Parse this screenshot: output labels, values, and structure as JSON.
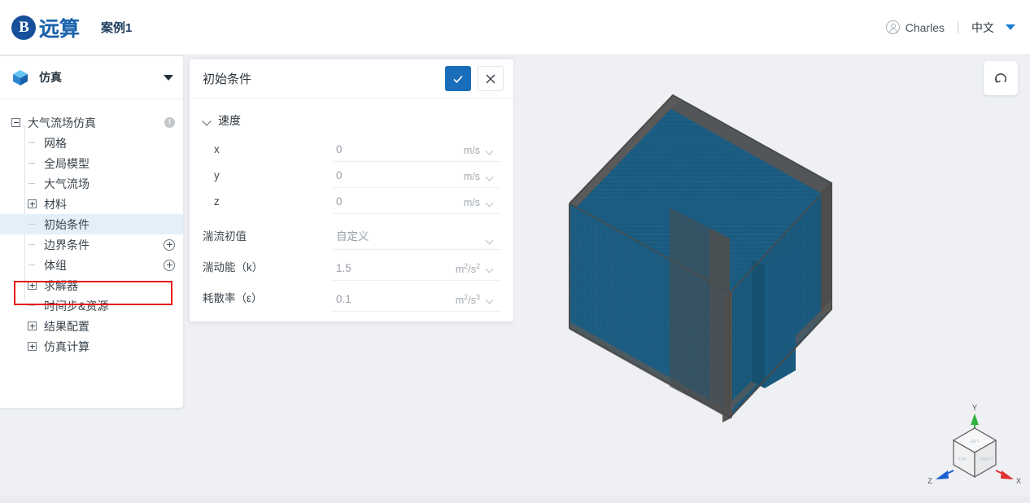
{
  "topbar": {
    "logo_text": "远算",
    "logo_glyph": "B",
    "case_title": "案例1",
    "user_name": "Charles",
    "language": "中文",
    "avatar_icon": "user-avatar-icon",
    "lang_caret_icon": "caret-down-icon",
    "accent_color": "#1a7fd4"
  },
  "sidebar": {
    "header": {
      "label": "仿真",
      "icon": "cube-icon",
      "caret_icon": "caret-down-icon"
    },
    "tree": [
      {
        "label": "大气流场仿真",
        "level": 0,
        "toggle": "minus",
        "trail": "info",
        "trail_text": "!",
        "selected": false
      },
      {
        "label": "网格",
        "level": 1,
        "toggle": "none",
        "trail": "none",
        "selected": false
      },
      {
        "label": "全局模型",
        "level": 1,
        "toggle": "none",
        "trail": "none",
        "selected": false
      },
      {
        "label": "大气流场",
        "level": 1,
        "toggle": "none",
        "trail": "none",
        "selected": false
      },
      {
        "label": "材料",
        "level": 1,
        "toggle": "plus",
        "trail": "none",
        "selected": false
      },
      {
        "label": "初始条件",
        "level": 1,
        "toggle": "none",
        "trail": "none",
        "selected": true
      },
      {
        "label": "边界条件",
        "level": 1,
        "toggle": "none",
        "trail": "plus-circle",
        "selected": false
      },
      {
        "label": "体组",
        "level": 1,
        "toggle": "none",
        "trail": "plus-circle",
        "selected": false
      },
      {
        "label": "求解器",
        "level": 1,
        "toggle": "plus",
        "trail": "none",
        "selected": false
      },
      {
        "label": "时间步&资源",
        "level": 1,
        "toggle": "none",
        "trail": "none",
        "selected": false
      },
      {
        "label": "结果配置",
        "level": 1,
        "toggle": "plus",
        "trail": "none",
        "selected": false
      },
      {
        "label": "仿真计算",
        "level": 1,
        "toggle": "plus",
        "trail": "none",
        "selected": false
      }
    ],
    "selection_highlight_color": "#e81313"
  },
  "panel": {
    "title": "初始条件",
    "confirm_icon": "check-icon",
    "close_icon": "close-icon",
    "confirm_color": "#1a6dba",
    "sections": [
      {
        "label": "速度",
        "expanded": true,
        "chevron_icon": "chevron-down-icon",
        "rows": [
          {
            "label": "x",
            "value": "0",
            "unit": "m/s",
            "unit_caret": "chevron-down-icon",
            "indent": true
          },
          {
            "label": "y",
            "value": "0",
            "unit": "m/s",
            "unit_caret": "chevron-down-icon",
            "indent": true
          },
          {
            "label": "z",
            "value": "0",
            "unit": "m/s",
            "unit_caret": "chevron-down-icon",
            "indent": true
          }
        ]
      }
    ],
    "rows": [
      {
        "label": "湍流初值",
        "value": "自定义",
        "type": "select",
        "unit": "",
        "unit_caret": "chevron-down-icon"
      },
      {
        "label": "湍动能（k）",
        "value": "1.5",
        "type": "input",
        "unit": "m2/s2",
        "unit_base": "m",
        "unit_sup1": "2",
        "unit_mid": "/s",
        "unit_sup2": "2",
        "unit_caret": "chevron-down-icon"
      },
      {
        "label": "耗散率（ε）",
        "value": "0.1",
        "type": "input",
        "unit": "m2/s3",
        "unit_base": "m",
        "unit_sup1": "2",
        "unit_mid": "/s",
        "unit_sup2": "3",
        "unit_caret": "chevron-down-icon"
      }
    ]
  },
  "viewport": {
    "background_color": "#eef0f4",
    "reset_button_icon": "reset-view-icon",
    "mesh": {
      "face_color": "#1c5f85",
      "edge_color": "#4b4b4b",
      "description": "3d-box-mesh"
    },
    "gizmo": {
      "axis_x_label": "X",
      "axis_y_label": "Y",
      "axis_z_label": "Z",
      "axis_x_color": "#e03131",
      "axis_y_color": "#2fb344",
      "axis_z_color": "#1c5fd0",
      "face_left": "LEFT",
      "face_top": "TOP",
      "face_right": "RIGHT"
    }
  }
}
